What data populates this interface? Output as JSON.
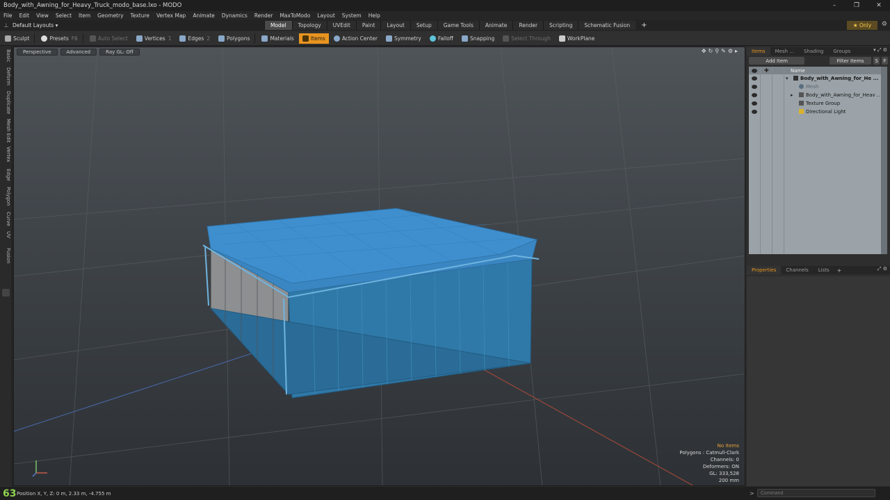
{
  "window": {
    "title": "Body_with_Awning_for_Heavy_Truck_modo_base.lxo - MODO"
  },
  "menu": [
    "File",
    "Edit",
    "View",
    "Select",
    "Item",
    "Geometry",
    "Texture",
    "Vertex Map",
    "Animate",
    "Dynamics",
    "Render",
    "MaxToModo",
    "Layout",
    "System",
    "Help"
  ],
  "layouts": {
    "label": "Default Layouts ▾"
  },
  "tabs": [
    "Model",
    "Topology",
    "UVEdit",
    "Paint",
    "Layout",
    "Setup",
    "Game Tools",
    "Animate",
    "Render",
    "Scripting",
    "Schematic Fusion"
  ],
  "only_label": "★  Only",
  "toolbar": {
    "sculpt": "Sculpt",
    "presets": "Presets",
    "presets_key": "F6",
    "auto_select": "Auto Select",
    "vertices": "Vertices",
    "vertices_key": "1",
    "edges": "Edges",
    "edges_key": "2",
    "polygons": "Polygons",
    "materials": "Materials",
    "items": "Items",
    "action_center": "Action Center",
    "symmetry": "Symmetry",
    "falloff": "Falloff",
    "snapping": "Snapping",
    "select_through": "Select Through",
    "workplane": "WorkPlane"
  },
  "left_tabs": [
    "Basic",
    "Deform",
    "Duplicate",
    "Mesh Edit",
    "Vertex",
    "Edge",
    "Polygon",
    "Curve",
    "UV",
    "Fusion"
  ],
  "viewport": {
    "view_mode": "Perspective",
    "shading": "Advanced",
    "raygl": "Ray GL: Off",
    "info": {
      "selection": "No Items",
      "polygons": "Polygons : Catmull-Clark",
      "channels": "Channels: 0",
      "deformers": "Deformers: ON",
      "gl": "GL: 333,528",
      "scale": "200 mm"
    }
  },
  "status": {
    "fps": "63",
    "position": "Position X, Y, Z:   0 m, 2.33 m, -4.755 m",
    "command_placeholder": "Command"
  },
  "items_panel": {
    "tabs": [
      "Items",
      "Mesh ...",
      "Shading",
      "Groups"
    ],
    "add_item": "Add Item",
    "filter_items": "Filter Items",
    "btn_s": "S",
    "btn_f": "F",
    "column_name": "Name",
    "rows": [
      {
        "label": "Body_with_Awning_for_He ...",
        "bold": true
      },
      {
        "label": "Mesh",
        "dim": true
      },
      {
        "label": "Body_with_Awning_for_Heav ..."
      },
      {
        "label": "Texture Group"
      },
      {
        "label": "Directional Light"
      }
    ]
  },
  "props_panel": {
    "tabs": [
      "Properties",
      "Channels",
      "Lists"
    ]
  },
  "colors": {
    "accent": "#e8941f",
    "fps": "#8fd14f",
    "mesh_blue": "#2f79a8",
    "panel_list": "#9ba3a8"
  }
}
